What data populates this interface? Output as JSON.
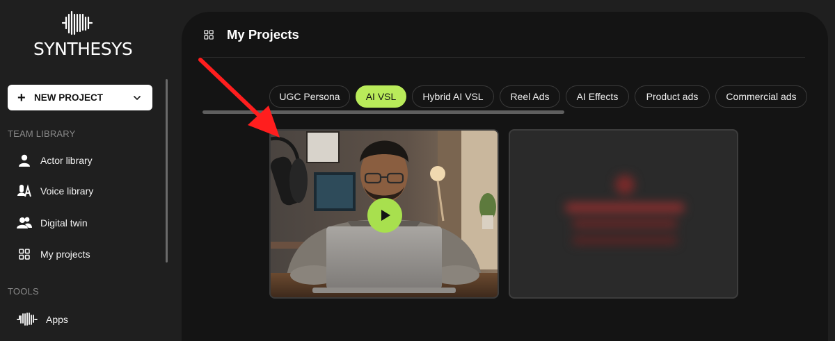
{
  "app": {
    "brand": "SYNTHESYS"
  },
  "sidebar": {
    "new_project_label": "NEW PROJECT",
    "sections": [
      {
        "title": "TEAM LIBRARY",
        "items": [
          {
            "label": "Actor library",
            "icon": "person-icon"
          },
          {
            "label": "Voice library",
            "icon": "voice-icon"
          },
          {
            "label": "Digital twin",
            "icon": "people-icon"
          },
          {
            "label": "My projects",
            "icon": "grid-icon"
          }
        ]
      },
      {
        "title": "TOOLS",
        "items": [
          {
            "label": "Apps",
            "icon": "waveform-icon"
          }
        ]
      }
    ]
  },
  "header": {
    "title": "My Projects",
    "icon": "grid-icon"
  },
  "tabs": [
    {
      "label": "UGC Persona",
      "active": false
    },
    {
      "label": "AI VSL",
      "active": true
    },
    {
      "label": "Hybrid AI VSL",
      "active": false
    },
    {
      "label": "Reel Ads",
      "active": false
    },
    {
      "label": "AI Effects",
      "active": false
    },
    {
      "label": "Product ads",
      "active": false
    },
    {
      "label": "Commercial ads",
      "active": false
    }
  ],
  "projects": [
    {
      "type": "video",
      "thumbnail": "man-at-laptop-with-microphone",
      "icon": "play-icon"
    },
    {
      "type": "blurred",
      "thumbnail": "blurred-preview"
    }
  ],
  "annotation": {
    "type": "arrow",
    "color": "#ff1e1e",
    "points_to": "first project card"
  },
  "colors": {
    "accent": "#b9eb5a",
    "background": "#1f1f1f",
    "panel": "#141414",
    "annotation": "#ff1e1e"
  }
}
